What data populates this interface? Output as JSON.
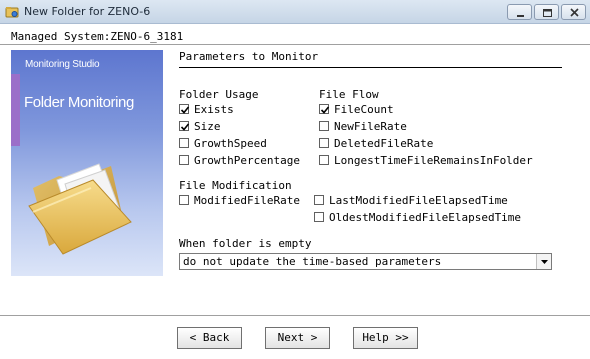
{
  "window": {
    "title": "New Folder for ZENO-6",
    "icon": "app-folder-icon",
    "controls": [
      "minimize-icon",
      "maximize-icon",
      "close-icon"
    ]
  },
  "managed_system": "Managed System:ZENO-6_3181",
  "splash": {
    "brand": "Monitoring Studio",
    "heading": "Folder Monitoring"
  },
  "section_title": "Parameters to Monitor",
  "folder_usage": {
    "label": "Folder Usage",
    "items": [
      {
        "label": "Exists",
        "checked": true
      },
      {
        "label": "Size",
        "checked": true
      },
      {
        "label": "GrowthSpeed",
        "checked": false
      },
      {
        "label": "GrowthPercentage",
        "checked": false
      }
    ]
  },
  "file_flow": {
    "label": "File Flow",
    "items": [
      {
        "label": "FileCount",
        "checked": true
      },
      {
        "label": "NewFileRate",
        "checked": false
      },
      {
        "label": "DeletedFileRate",
        "checked": false
      },
      {
        "label": "LongestTimeFileRemainsInFolder",
        "checked": false
      }
    ]
  },
  "file_modification": {
    "label": "File Modification",
    "items": [
      {
        "label": "ModifiedFileRate",
        "checked": false
      },
      {
        "label": "LastModifiedFileElapsedTime",
        "checked": false
      },
      {
        "label": "OldestModifiedFileElapsedTime",
        "checked": false
      }
    ]
  },
  "empty_folder": {
    "label": "When folder is empty",
    "selected": "do not update the time-based parameters"
  },
  "buttons": {
    "back": "< Back",
    "next": "Next >",
    "help": "Help >>"
  },
  "colors": {
    "titlebar": "#c6d5e6",
    "splash": "#7f97dc",
    "accent_bar": "#9b6fc9"
  }
}
